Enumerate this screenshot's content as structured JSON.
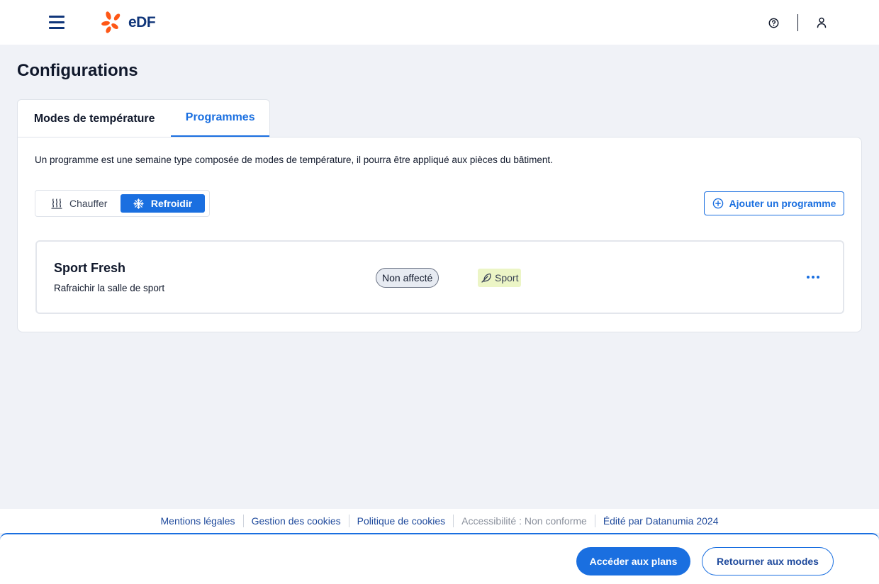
{
  "header": {
    "logo_text": "eDF",
    "menu_icon": "hamburger-menu-icon",
    "help_icon": "help-circle-icon",
    "user_icon": "user-icon"
  },
  "page": {
    "title": "Configurations"
  },
  "tabs": [
    {
      "label": "Modes de température",
      "active": false
    },
    {
      "label": "Programmes",
      "active": true
    }
  ],
  "programmes": {
    "intro": "Un programme est une semaine type composée de modes de température, il pourra être appliqué aux pièces du bâtiment.",
    "segmented": {
      "heat_label": "Chauffer",
      "cool_label": "Refroidir",
      "selected": "Refroidir"
    },
    "add_button_label": "Ajouter un programme",
    "items": [
      {
        "name": "Sport Fresh",
        "description": "Rafraichir la salle de sport",
        "status": "Non affecté",
        "tag": "Sport"
      }
    ]
  },
  "footer": {
    "links": [
      "Mentions légales",
      "Gestion des cookies",
      "Politique de cookies",
      "Accessibilité : Non conforme",
      "Édité par Datanumia 2024"
    ]
  },
  "actions": {
    "primary_label": "Accéder aux plans",
    "secondary_label": "Retourner aux modes"
  },
  "colors": {
    "accent": "#1a6fe0",
    "brand_navy": "#10367a",
    "brand_orange": "#fe5716",
    "tag_bg": "#ecf5c6",
    "page_bg": "#f0f2f7"
  }
}
